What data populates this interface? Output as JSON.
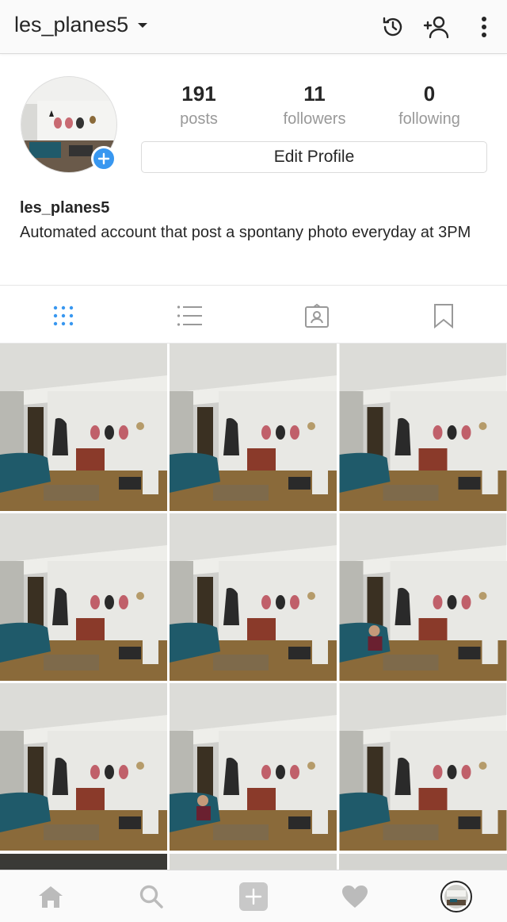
{
  "header": {
    "username": "les_planes5",
    "icons": [
      "history-icon",
      "add-user-icon",
      "more-options-icon"
    ]
  },
  "profile": {
    "stats": [
      {
        "number": "191",
        "label": "posts"
      },
      {
        "number": "11",
        "label": "followers"
      },
      {
        "number": "0",
        "label": "following"
      }
    ],
    "edit_label": "Edit Profile",
    "name": "les_planes5",
    "bio": "Automated account that post a spontany photo everyday at 3PM"
  },
  "tabs": [
    "grid-view-icon",
    "list-view-icon",
    "tagged-icon",
    "saved-icon"
  ],
  "grid": {
    "post_count_visible": 9,
    "person_in_photo": [
      false,
      false,
      false,
      false,
      false,
      true,
      false,
      true,
      false
    ]
  },
  "bottom_nav": [
    "home-icon",
    "search-icon",
    "new-post-icon",
    "activity-heart-icon",
    "profile-avatar"
  ],
  "colors": {
    "accent": "#3897f0",
    "wall": "#e8e8e4",
    "sofa": "#1f5a6a",
    "floor": "#8a6a3a",
    "guitar": "#c0606a"
  }
}
